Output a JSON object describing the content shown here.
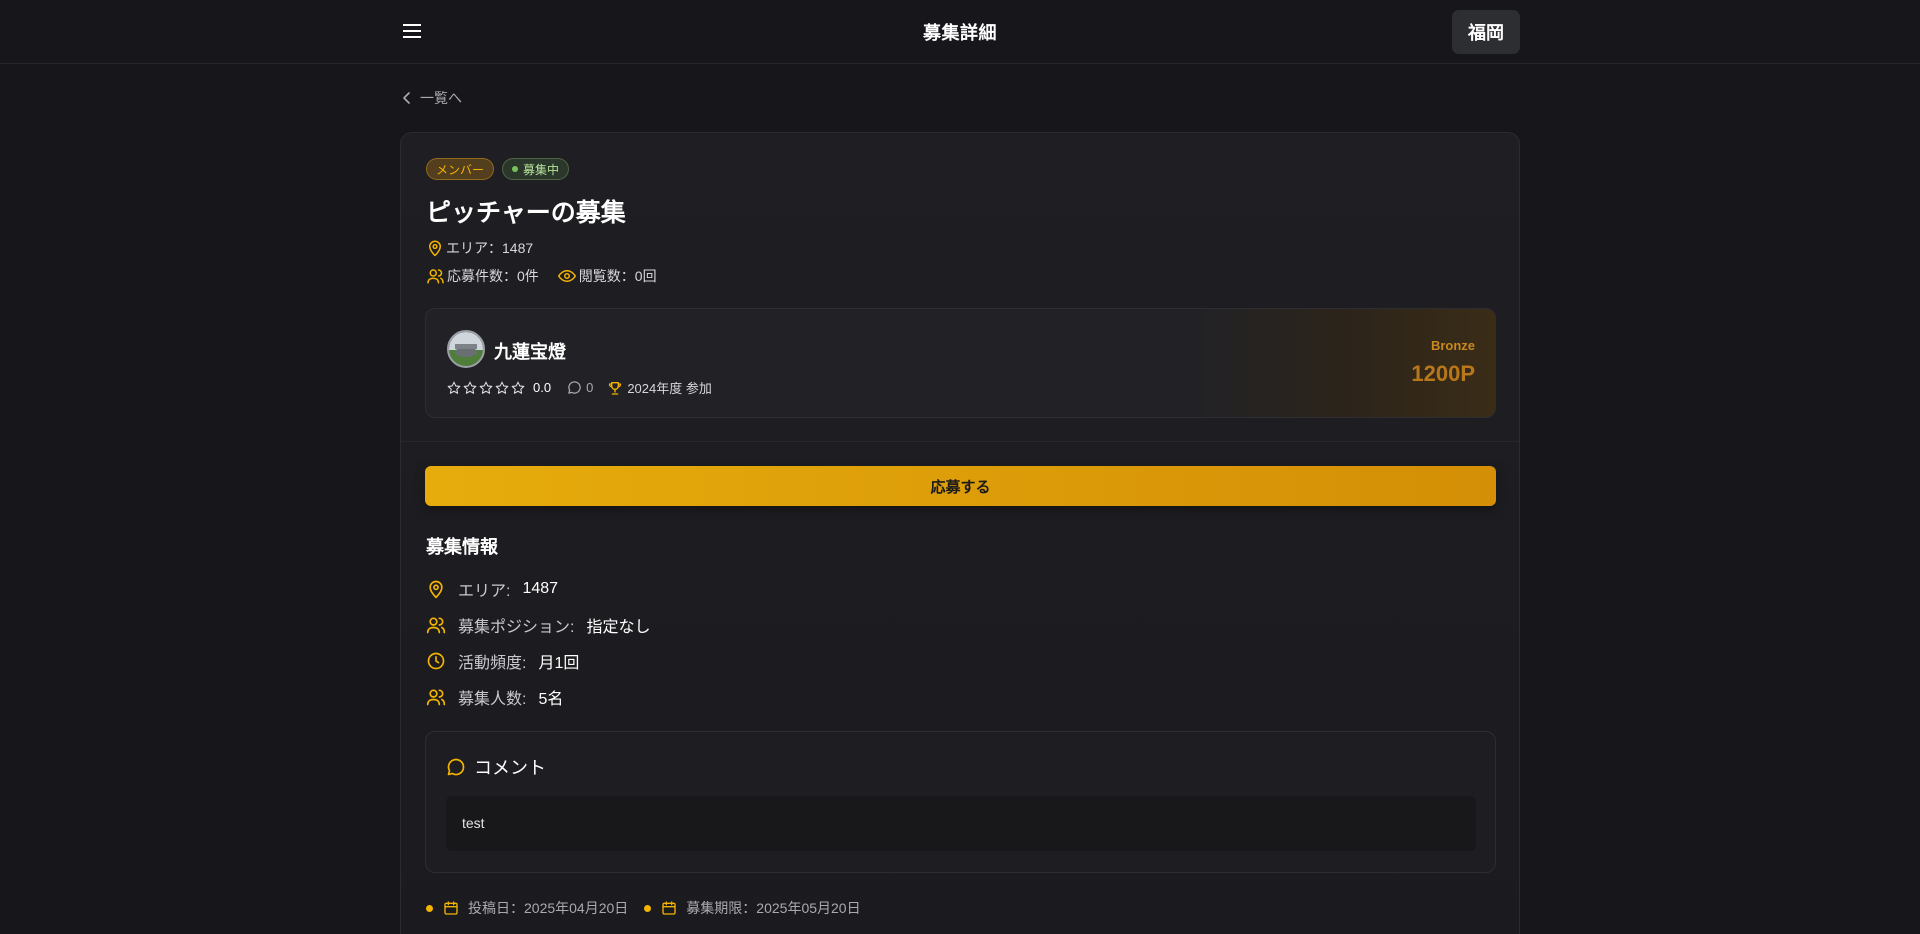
{
  "header": {
    "title": "募集詳細",
    "region_button": "福岡"
  },
  "nav": {
    "back_label": "一覧へ"
  },
  "post": {
    "badges": {
      "member": "メンバー",
      "status": "募集中"
    },
    "title": "ピッチャーの募集",
    "area": "エリア：1487",
    "applications": "応募件数：0件",
    "views": "閲覧数：0回"
  },
  "user": {
    "name": "九蓮宝燈",
    "rating": "0.0",
    "comment_count": "0",
    "participation": "2024年度 参加",
    "rank": "Bronze",
    "points": "1200P"
  },
  "actions": {
    "apply_label": "応募する"
  },
  "recruitment_info": {
    "title": "募集情報",
    "rows": [
      {
        "label": "エリア:",
        "value": "1487",
        "icon": "map-pin-icon"
      },
      {
        "label": "募集ポジション:",
        "value": "指定なし",
        "icon": "users-icon"
      },
      {
        "label": "活動頻度:",
        "value": "月1回",
        "icon": "clock-icon"
      },
      {
        "label": "募集人数:",
        "value": "5名",
        "icon": "users-icon"
      }
    ]
  },
  "comment": {
    "title": "コメント",
    "text": "test"
  },
  "dates": {
    "posted": "投稿日：2025年04月20日",
    "deadline": "募集期限：2025年05月20日"
  },
  "colors": {
    "accent": "#f4b400",
    "background": "#17171b",
    "rank": "#b8771a"
  }
}
